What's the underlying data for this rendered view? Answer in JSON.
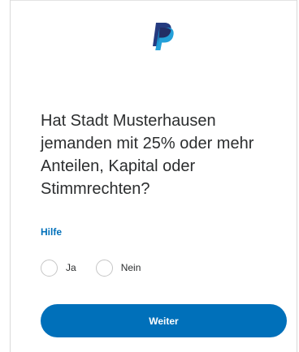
{
  "brand": {
    "logo_icon": "paypal-logo-icon",
    "colors": {
      "logo_dark": "#253b80",
      "logo_light": "#179bd7",
      "accent": "#0070ba",
      "text": "#2c2e2f",
      "radio_border": "#c6c6c6"
    }
  },
  "form": {
    "question": "Hat Stadt Musterhausen jemanden mit 25% oder mehr Anteilen, Kapital oder Stimmrechten?",
    "help_label": "Hilfe",
    "options": [
      {
        "label": "Ja",
        "selected": false
      },
      {
        "label": "Nein",
        "selected": false
      }
    ],
    "submit_label": "Weiter"
  }
}
